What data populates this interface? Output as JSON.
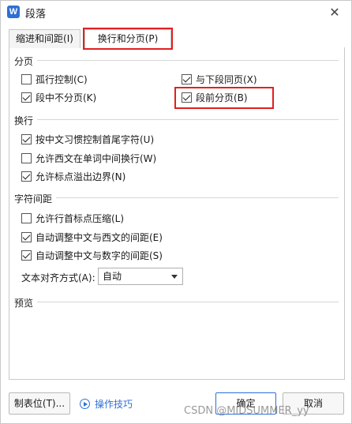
{
  "window": {
    "app_icon_text": "W",
    "title": "段落",
    "close_glyph": "✕"
  },
  "tabs": [
    {
      "label": "缩进和间距(I)"
    },
    {
      "label": "换行和分页(P)"
    }
  ],
  "sections": {
    "pagination": {
      "title": "分页",
      "options": [
        {
          "label": "孤行控制(C)",
          "checked": false
        },
        {
          "label": "与下段同页(X)",
          "checked": true
        },
        {
          "label": "段中不分页(K)",
          "checked": true
        },
        {
          "label": "段前分页(B)",
          "checked": true
        }
      ]
    },
    "line_break": {
      "title": "换行",
      "options": [
        {
          "label": "按中文习惯控制首尾字符(U)",
          "checked": true
        },
        {
          "label": "允许西文在单词中间换行(W)",
          "checked": false
        },
        {
          "label": "允许标点溢出边界(N)",
          "checked": true
        }
      ]
    },
    "char_spacing": {
      "title": "字符间距",
      "options": [
        {
          "label": "允许行首标点压缩(L)",
          "checked": false
        },
        {
          "label": "自动调整中文与西文的间距(E)",
          "checked": true
        },
        {
          "label": "自动调整中文与数字的间距(S)",
          "checked": true
        }
      ],
      "text_align_label": "文本对齐方式(A):",
      "text_align_value": "自动"
    },
    "preview": {
      "title": "预览"
    }
  },
  "footer": {
    "tabs_button": "制表位(T)...",
    "tips_link": "操作技巧",
    "ok_button": "确定",
    "cancel_button": "取消"
  },
  "watermark": "CSDN @MIDSUMMER_yy",
  "colors": {
    "accent": "#2f6fd6",
    "highlight": "#e02020"
  }
}
